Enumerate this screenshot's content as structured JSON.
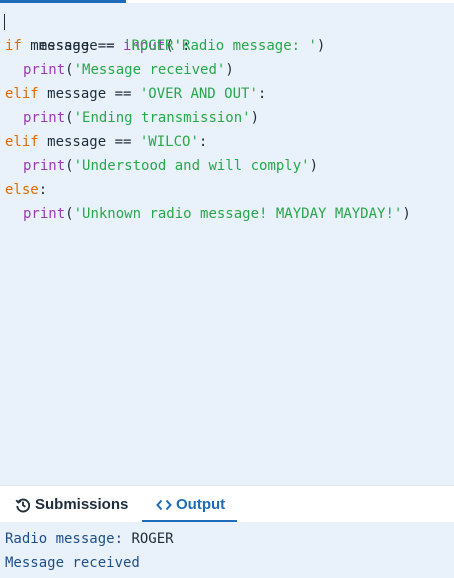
{
  "editor": {
    "lines": [
      [
        "message",
        " = ",
        "input",
        "(",
        "'Radio message: '",
        ")"
      ],
      [
        "if",
        " message == ",
        "'ROGER'",
        ":"
      ],
      [
        "print",
        "(",
        "'Message received'",
        ")"
      ],
      [
        "elif",
        " message == ",
        "'OVER AND OUT'",
        ":"
      ],
      [
        "print",
        "(",
        "'Ending transmission'",
        ")"
      ],
      [
        "elif",
        " message == ",
        "'WILCO'",
        ":"
      ],
      [
        "print",
        "(",
        "'Understood and will comply'",
        ")"
      ],
      [
        "else",
        ":"
      ],
      [
        "print",
        "(",
        "'Unknown radio message! MAYDAY MAYDAY!'",
        ")"
      ]
    ]
  },
  "tabs": {
    "submissions": {
      "label": "Submissions",
      "icon": "history-icon"
    },
    "output": {
      "label": "Output",
      "icon": "code-icon",
      "active": true
    }
  },
  "output": {
    "prompt": "Radio message: ",
    "input_value": "ROGER",
    "result": "Message received"
  },
  "colors": {
    "accent": "#1e6bb8",
    "editor_bg": "#e9f2fb",
    "keyword": "#e06c00",
    "builtin": "#9b39b7",
    "string": "#27a84a"
  }
}
